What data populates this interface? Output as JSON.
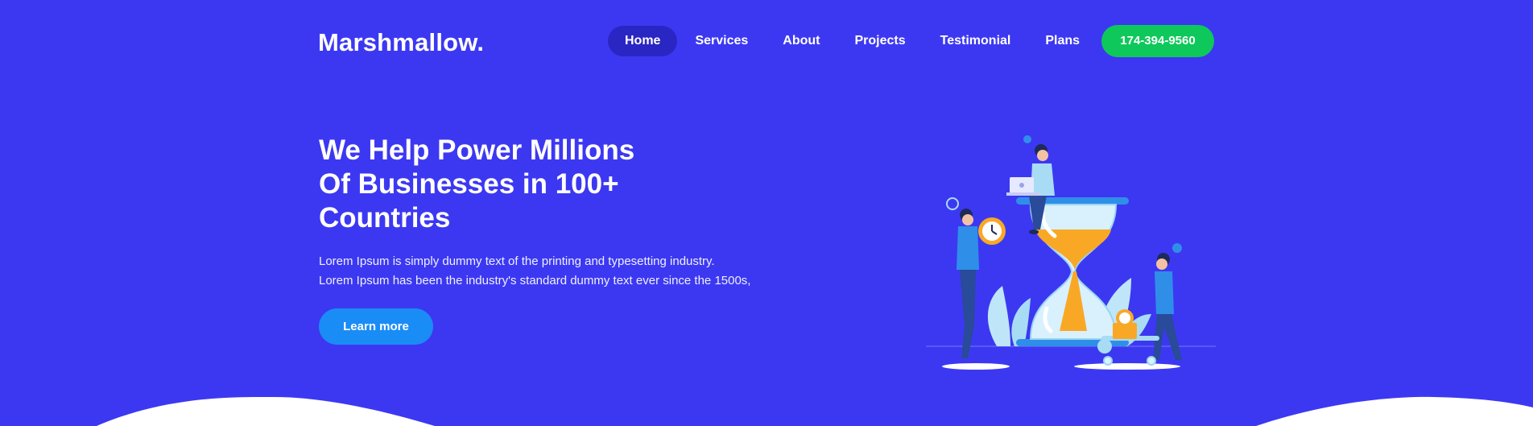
{
  "header": {
    "logo": "Marshmallow.",
    "nav": [
      {
        "label": "Home",
        "active": true
      },
      {
        "label": "Services",
        "active": false
      },
      {
        "label": "About",
        "active": false
      },
      {
        "label": "Projects",
        "active": false
      },
      {
        "label": "Testimonial",
        "active": false
      },
      {
        "label": "Plans",
        "active": false
      }
    ],
    "phone": "174-394-9560"
  },
  "hero": {
    "title_lines": [
      "We Help Power Millions",
      "Of Businesses in 100+",
      "Countries"
    ],
    "text_lines": [
      "Lorem Ipsum is simply dummy text of the printing and typesetting industry.",
      "Lorem Ipsum has been the industry's standard dummy text ever since the 1500s,"
    ],
    "cta_label": "Learn more"
  },
  "colors": {
    "background": "#3c38f2",
    "active_nav": "#2a26c4",
    "phone_button": "#0ec85b",
    "cta_button": "#1a8cf6",
    "hourglass_sand": "#f9a826"
  },
  "illustration": {
    "icons": [
      "hourglass-icon",
      "person-laptop-icon",
      "person-clock-icon",
      "person-cart-icon",
      "plant-icon"
    ]
  }
}
